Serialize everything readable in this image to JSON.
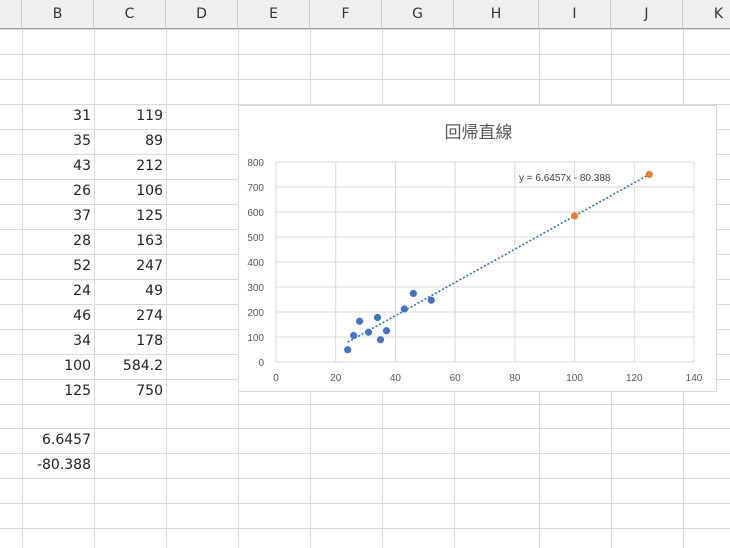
{
  "columns": [
    "B",
    "C",
    "D",
    "E",
    "F",
    "G",
    "H",
    "I",
    "J",
    "K"
  ],
  "data_rows": [
    {
      "b": "31",
      "c": "119"
    },
    {
      "b": "35",
      "c": "89"
    },
    {
      "b": "43",
      "c": "212"
    },
    {
      "b": "26",
      "c": "106"
    },
    {
      "b": "37",
      "c": "125"
    },
    {
      "b": "28",
      "c": "163"
    },
    {
      "b": "52",
      "c": "247"
    },
    {
      "b": "24",
      "c": "49"
    },
    {
      "b": "46",
      "c": "274"
    },
    {
      "b": "34",
      "c": "178"
    },
    {
      "b": "100",
      "c": "584.2"
    },
    {
      "b": "125",
      "c": "750"
    }
  ],
  "coefficients": {
    "slope": "6.6457",
    "intercept": "-80.388"
  },
  "chart_data": {
    "type": "scatter",
    "title": "回帰直線",
    "xlim": [
      0,
      140
    ],
    "ylim": [
      0,
      800
    ],
    "x_ticks": [
      "0",
      "20",
      "40",
      "60",
      "80",
      "100",
      "120",
      "140"
    ],
    "y_ticks": [
      "0",
      "100",
      "200",
      "300",
      "400",
      "500",
      "600",
      "700",
      "800"
    ],
    "grid": true,
    "series": [
      {
        "color": "#4472c4",
        "points": [
          [
            31,
            119
          ],
          [
            35,
            89
          ],
          [
            43,
            212
          ],
          [
            26,
            106
          ],
          [
            37,
            125
          ],
          [
            28,
            163
          ],
          [
            52,
            247
          ],
          [
            24,
            49
          ],
          [
            46,
            274
          ],
          [
            34,
            178
          ]
        ]
      },
      {
        "color": "#ed7d31",
        "points": [
          [
            100,
            584.2
          ],
          [
            125,
            750
          ]
        ]
      }
    ],
    "trendline": {
      "slope": 6.6457,
      "intercept": -80.388,
      "x_range": [
        24,
        125
      ],
      "color": "#2e75b6",
      "label": "y = 6.6457x - 80.388"
    }
  }
}
